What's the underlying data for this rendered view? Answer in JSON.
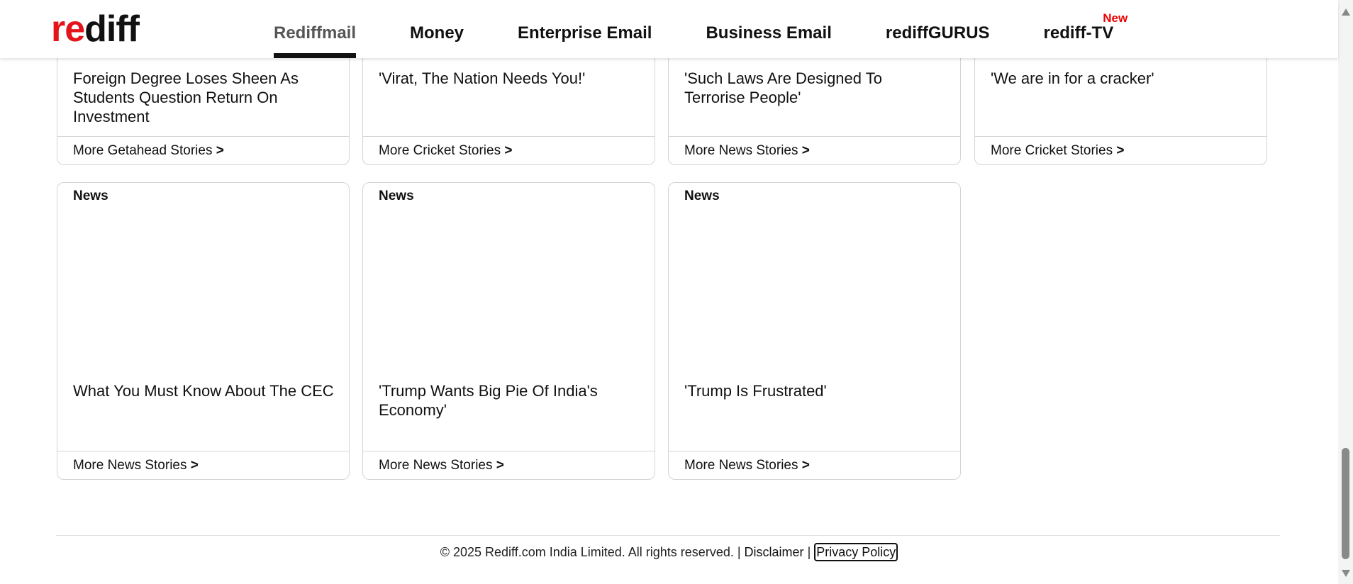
{
  "logo": {
    "text": "rediff"
  },
  "nav": [
    {
      "label": "Rediffmail",
      "active": true
    },
    {
      "label": "Money"
    },
    {
      "label": "Enterprise Email"
    },
    {
      "label": "Business Email"
    },
    {
      "label": "rediffGURUS"
    },
    {
      "label": "rediff-TV",
      "badge": "New"
    }
  ],
  "top_row": [
    {
      "title": "Foreign Degree Loses Sheen As Students Question Return On Investment",
      "more": "More Getahead Stories"
    },
    {
      "title": "'Virat, The Nation Needs You!'",
      "more": "More Cricket Stories"
    },
    {
      "title": "'Such Laws Are Designed To Terrorise People'",
      "more": "More News Stories"
    },
    {
      "title": "'We are in for a cracker'",
      "more": "More Cricket Stories"
    }
  ],
  "bottom_row": [
    {
      "category": "News",
      "title": "What You Must Know About The CEC",
      "more": "More News Stories"
    },
    {
      "category": "News",
      "title": "'Trump Wants Big Pie Of India's Economy'",
      "more": "More News Stories"
    },
    {
      "category": "News",
      "title": "'Trump Is Frustrated'",
      "more": "More News Stories"
    }
  ],
  "more_arrow": ">",
  "footer": {
    "copyright": "© 2025 Rediff.com India Limited. All rights reserved. |",
    "disclaimer": "Disclaimer",
    "separator": "|",
    "privacy": "Privacy Policy"
  },
  "colors": {
    "logo_red": "#e4141b",
    "badge_red": "#e00000",
    "accent_dark": "#111111"
  }
}
